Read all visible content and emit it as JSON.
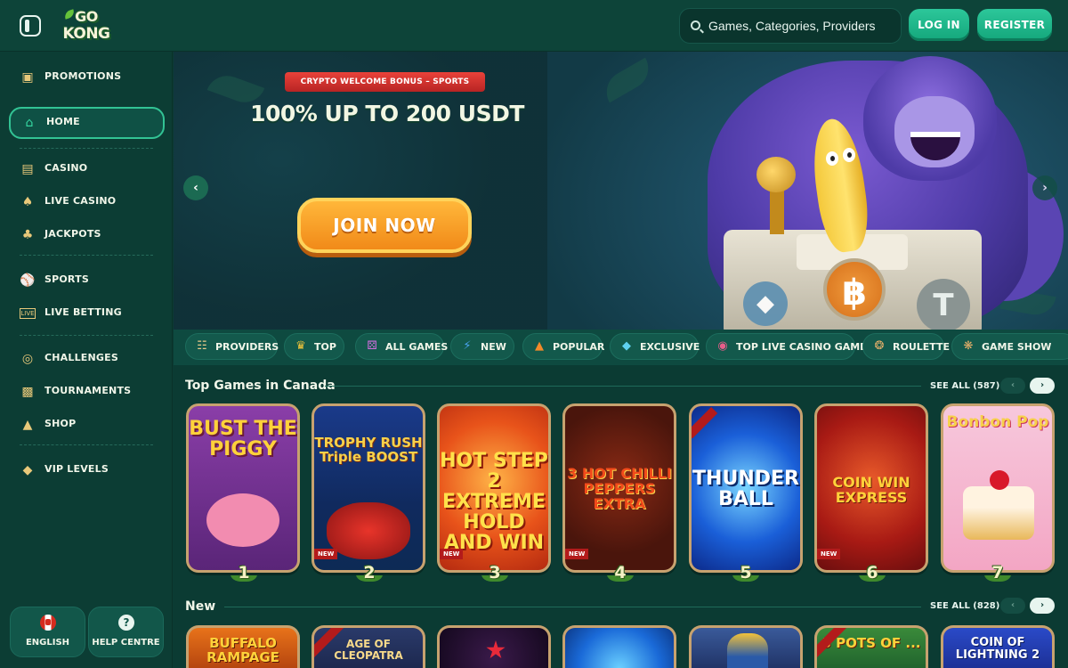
{
  "header": {
    "logo_line1": "GO",
    "logo_line2": "KONG",
    "search_placeholder": "Games, Categories, Providers",
    "login_label": "LOG IN",
    "register_label": "REGISTER"
  },
  "sidebar": {
    "items": [
      {
        "label": "PROMOTIONS",
        "icon": "gift-icon"
      },
      {
        "label": "HOME",
        "icon": "home-icon",
        "active": true
      },
      {
        "label": "CASINO",
        "icon": "slot-machine-icon"
      },
      {
        "label": "LIVE CASINO",
        "icon": "playing-card-icon"
      },
      {
        "label": "JACKPOTS",
        "icon": "clover-icon"
      },
      {
        "label": "SPORTS",
        "icon": "ball-icon"
      },
      {
        "label": "LIVE BETTING",
        "icon": "live-icon"
      },
      {
        "label": "CHALLENGES",
        "icon": "target-icon"
      },
      {
        "label": "TOURNAMENTS",
        "icon": "leaderboard-icon"
      },
      {
        "label": "SHOP",
        "icon": "basket-icon"
      },
      {
        "label": "VIP LEVELS",
        "icon": "diamond-icon"
      }
    ],
    "language_label": "ENGLISH",
    "help_label": "HELP CENTRE"
  },
  "hero": {
    "tag": "CRYPTO WELCOME BONUS – SPORTS",
    "headline": "100% UP TO 200 USDT",
    "cta": "JOIN NOW",
    "slide_count": 4,
    "active_slide": 4
  },
  "categories": [
    {
      "label": "PROVIDERS",
      "icon": "scroll-icon"
    },
    {
      "label": "TOP",
      "icon": "crown-icon"
    },
    {
      "label": "ALL GAMES",
      "icon": "dice-icon"
    },
    {
      "label": "NEW",
      "icon": "lightning-icon"
    },
    {
      "label": "POPULAR",
      "icon": "flame-icon"
    },
    {
      "label": "EXCLUSIVE",
      "icon": "diamond-icon"
    },
    {
      "label": "TOP LIVE CASINO GAMES",
      "icon": "chip-icon"
    },
    {
      "label": "ROULETTE",
      "icon": "roulette-icon"
    },
    {
      "label": "GAME SHOW",
      "icon": "wheel-icon"
    }
  ],
  "top_games": {
    "title": "Top Games in Canada",
    "see_all": "SEE ALL (587)",
    "games": [
      {
        "title": "BUST THE PIGGY",
        "rank": "1",
        "new": false,
        "new_label": ""
      },
      {
        "title": "TROPHY RUSH Triple BOOST",
        "rank": "2",
        "new": true,
        "new_label": "NEW"
      },
      {
        "title": "HOT STEP 2 EXTREME HOLD AND WIN",
        "rank": "3",
        "new": true,
        "new_label": "NEW"
      },
      {
        "title": "3 HOT CHILLI PEPPERS EXTRA",
        "rank": "4",
        "new": true,
        "new_label": "NEW"
      },
      {
        "title": "THUNDER BALL",
        "rank": "5",
        "new": false,
        "new_label": ""
      },
      {
        "title": "COIN WIN EXPRESS",
        "rank": "6",
        "new": true,
        "new_label": "NEW"
      },
      {
        "title": "Bonbon Pop",
        "rank": "7",
        "new": false,
        "new_label": ""
      }
    ]
  },
  "new_games": {
    "title": "New",
    "see_all": "SEE ALL (828)",
    "games": [
      {
        "title": "BUFFALO RAMPAGE"
      },
      {
        "title": "AGE OF CLEOPATRA"
      },
      {
        "title": ""
      },
      {
        "title": ""
      },
      {
        "title": ""
      },
      {
        "title": "3 POTS OF ..."
      },
      {
        "title": "COIN OF LIGHTNING 2"
      }
    ]
  },
  "colors": {
    "background": "#0b3b33",
    "accent": "#2cc79a",
    "cta_orange": "#f18a19",
    "card_border": "#c7a26f"
  }
}
